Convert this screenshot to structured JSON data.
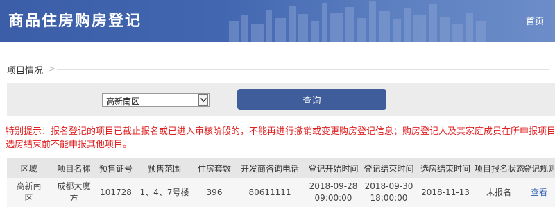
{
  "header": {
    "title": "商品住房购房登记",
    "home_link": "首页",
    "brand_color": "#3c5ea8"
  },
  "breadcrumb": {
    "label": "项目情况"
  },
  "search": {
    "region_selected": "高新南区",
    "query_button": "查询",
    "button_color": "#3f5d9b"
  },
  "notice": {
    "line1": "特别提示：报名登记的项目已截止报名或已进入审核阶段的，不能再进行撤销或变更购房登记信息；购房登记人及其家庭成员在所申报项目",
    "line2": "选房结束前不能申报其他项目。",
    "color": "#e02020"
  },
  "table": {
    "columns": [
      "区域",
      "项目名称",
      "预售证号",
      "预售范围",
      "住房套数",
      "开发商咨询电话",
      "登记开始时间",
      "登记结束时间",
      "选房结束时间",
      "项目报名状态",
      "登记规则"
    ],
    "rows": [
      {
        "region_1": "高新南",
        "region_2": "区",
        "name_1": "成都大魔",
        "name_2": "方",
        "presale_no": "101728",
        "presale_scope": "1、4、7号楼",
        "units": "396",
        "phone": "80611111",
        "reg_start_date": "2018-09-28",
        "reg_start_time": "09:00:00",
        "reg_end_date": "2018-09-30",
        "reg_end_time": "18:00:00",
        "selection_end": "2018-11-13",
        "status": "未报名",
        "rule_link": "查看"
      }
    ]
  }
}
